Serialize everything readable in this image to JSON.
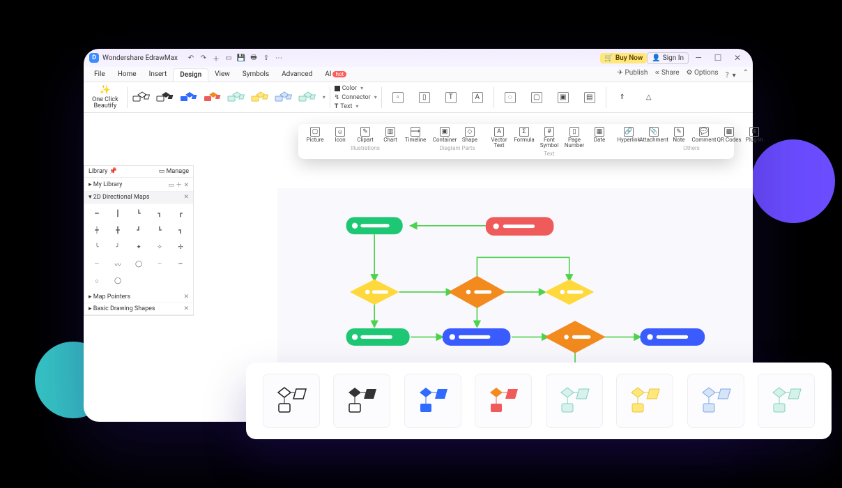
{
  "app": {
    "title": "Wondershare EdrawMax"
  },
  "titlebar": {
    "buy": "Buy Now",
    "signin": "Sign In"
  },
  "menu": {
    "items": [
      "File",
      "Home",
      "Insert",
      "Design",
      "View",
      "Symbols",
      "Advanced"
    ],
    "ai": "AI",
    "ai_badge": "hot",
    "active": "Design",
    "right": {
      "publish": "Publish",
      "share": "Share",
      "options": "Options"
    }
  },
  "ribbon": {
    "beautify": "One Click\nBeautify",
    "color": "Color",
    "connector": "Connector",
    "text": "Text"
  },
  "insert_strip": {
    "groups": [
      {
        "label": "Illustrations",
        "items": [
          "Picture",
          "Icon",
          "Clipart",
          "Chart",
          "Timeline"
        ]
      },
      {
        "label": "Diagram Parts",
        "items": [
          "Container",
          "Shape"
        ]
      },
      {
        "label": "Text",
        "items": [
          "Vector Text",
          "Formula",
          "Font Symbol",
          "Page Number",
          "Date"
        ]
      },
      {
        "label": "Others",
        "items": [
          "Hyperlink",
          "Attachment",
          "Note",
          "Comment",
          "QR Codes",
          "Plug-in"
        ]
      }
    ]
  },
  "library": {
    "title": "Library",
    "manage": "Manage",
    "mylib": "My Library",
    "sections": [
      "2D Directional Maps",
      "Map Pointers",
      "Basic Drawing Shapes"
    ]
  },
  "colors": {
    "green": "#1ec773",
    "red": "#ef5a5a",
    "yellow": "#ffd93b",
    "orange": "#f5a623",
    "orange2": "#f28a1e",
    "blue": "#3a5cff"
  },
  "presets": [
    {
      "stroke": "#222",
      "fill": "#fff",
      "accent": "#222"
    },
    {
      "stroke": "#222",
      "fill": "#fff",
      "accent": "#555"
    },
    {
      "stroke": "#2f6bff",
      "fill": "#2f6bff",
      "accent": "#2f6bff"
    },
    {
      "stroke": "#ef5a5a",
      "fill": "#ef5a5a",
      "accent": "#f28a1e"
    },
    {
      "stroke": "#9fd7d0",
      "fill": "#d9f1ee",
      "accent": "#9fd7d0"
    },
    {
      "stroke": "#e8c63b",
      "fill": "#ffe77a",
      "accent": "#e8c63b"
    },
    {
      "stroke": "#7aa7e8",
      "fill": "#d6e4f7",
      "accent": "#7aa7e8"
    },
    {
      "stroke": "#7fd1bd",
      "fill": "#d6f1ea",
      "accent": "#7fd1bd"
    }
  ]
}
